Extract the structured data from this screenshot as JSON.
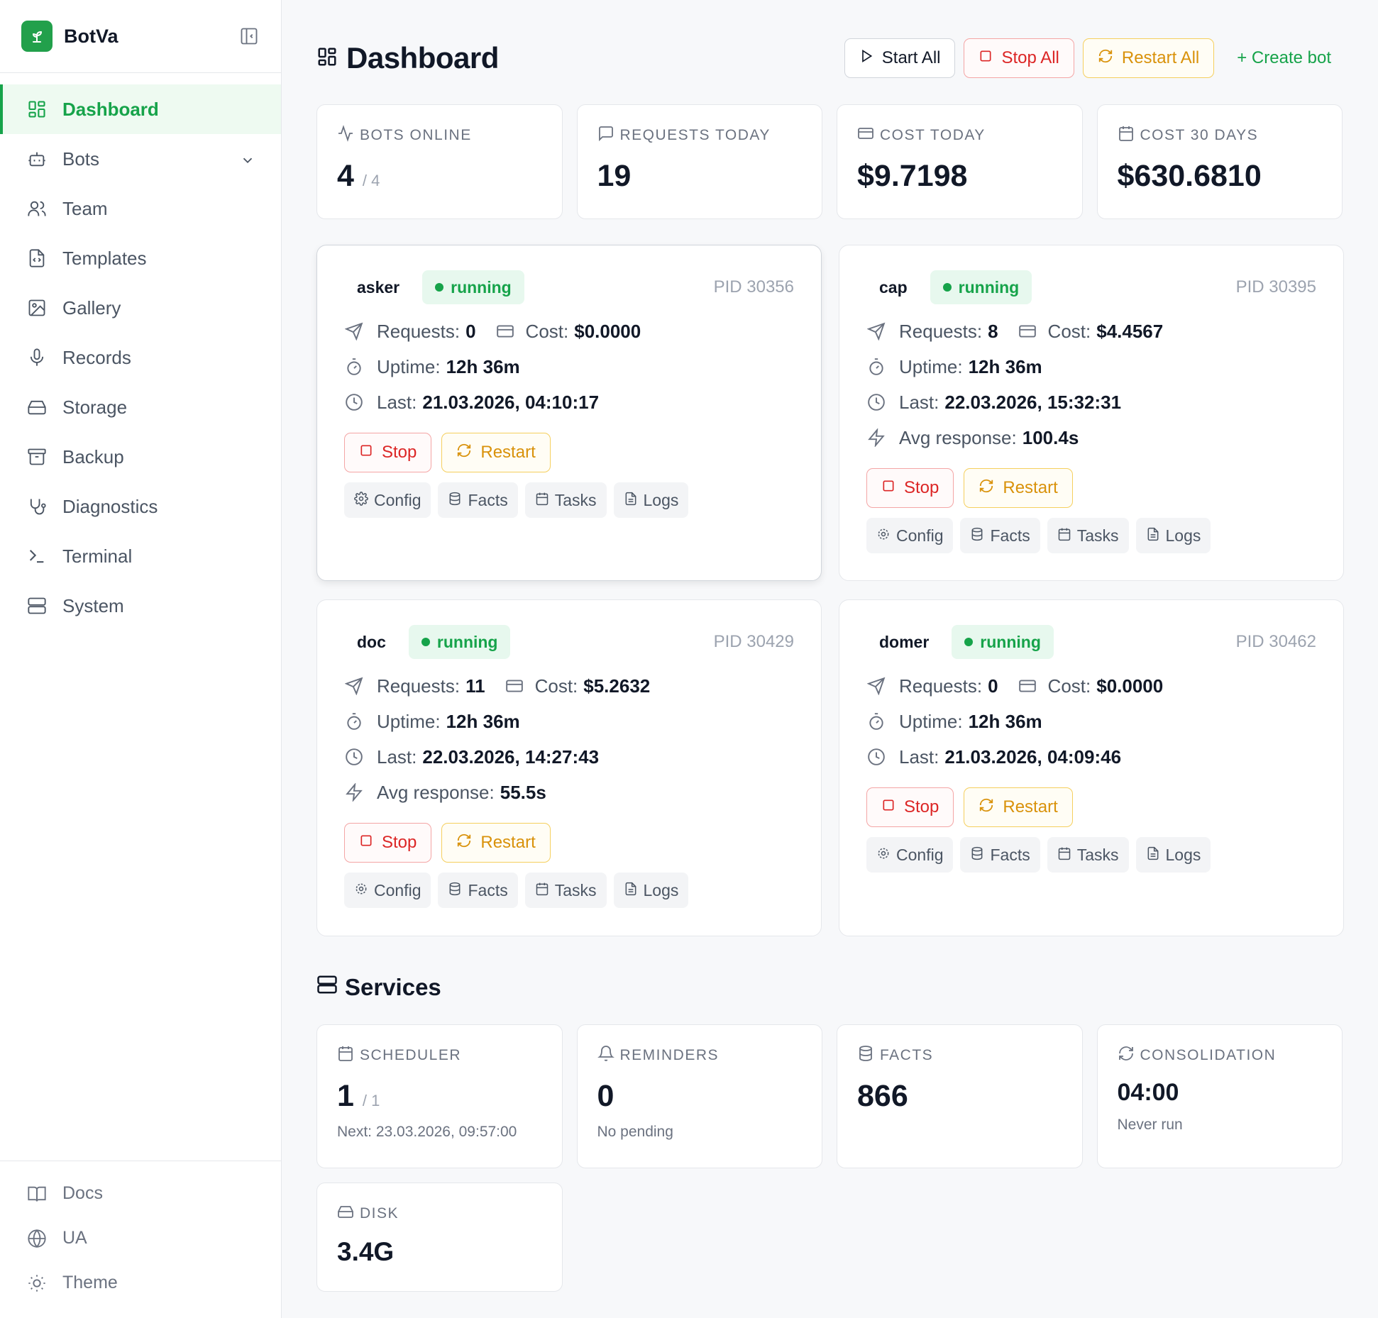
{
  "brand": {
    "name": "BotVa"
  },
  "sidebar": {
    "items": [
      {
        "label": "Dashboard",
        "icon": "layout-grid-icon",
        "active": true
      },
      {
        "label": "Bots",
        "icon": "bot-icon"
      },
      {
        "label": "Team",
        "icon": "users-icon"
      },
      {
        "label": "Templates",
        "icon": "file-code-icon"
      },
      {
        "label": "Gallery",
        "icon": "image-icon"
      },
      {
        "label": "Records",
        "icon": "mic-icon"
      },
      {
        "label": "Storage",
        "icon": "hard-drive-icon"
      },
      {
        "label": "Backup",
        "icon": "archive-icon"
      },
      {
        "label": "Diagnostics",
        "icon": "stethoscope-icon"
      },
      {
        "label": "Terminal",
        "icon": "terminal-icon"
      },
      {
        "label": "System",
        "icon": "server-icon"
      }
    ],
    "bottom": [
      {
        "label": "Docs",
        "icon": "book-icon"
      },
      {
        "label": "UA",
        "icon": "globe-icon"
      },
      {
        "label": "Theme",
        "icon": "sun-icon"
      }
    ]
  },
  "header": {
    "title": "Dashboard",
    "start_all": "Start All",
    "stop_all": "Stop All",
    "restart_all": "Restart All",
    "create_bot": "+ Create bot"
  },
  "stats": {
    "bots_online": {
      "label": "BOTS ONLINE",
      "value": "4",
      "total": "/ 4"
    },
    "requests_today": {
      "label": "REQUESTS TODAY",
      "value": "19"
    },
    "cost_today": {
      "label": "COST TODAY",
      "value": "$9.7198"
    },
    "cost_30": {
      "label": "COST 30 DAYS",
      "value": "$630.6810"
    }
  },
  "bot_labels": {
    "requests": "Requests:",
    "cost": "Cost:",
    "uptime": "Uptime:",
    "last": "Last:",
    "avg": "Avg response:",
    "stop": "Stop",
    "restart": "Restart",
    "config": "Config",
    "facts": "Facts",
    "tasks": "Tasks",
    "logs": "Logs"
  },
  "bots": [
    {
      "name": "asker",
      "status": "running",
      "pid": "PID 30356",
      "requests": "0",
      "cost": "$0.0000",
      "uptime": "12h 36m",
      "last": "21.03.2026, 04:10:17"
    },
    {
      "name": "cap",
      "status": "running",
      "pid": "PID 30395",
      "requests": "8",
      "cost": "$4.4567",
      "uptime": "12h 36m",
      "last": "22.03.2026, 15:32:31",
      "avg": "100.4s"
    },
    {
      "name": "doc",
      "status": "running",
      "pid": "PID 30429",
      "requests": "11",
      "cost": "$5.2632",
      "uptime": "12h 36m",
      "last": "22.03.2026, 14:27:43",
      "avg": "55.5s"
    },
    {
      "name": "domer",
      "status": "running",
      "pid": "PID 30462",
      "requests": "0",
      "cost": "$0.0000",
      "uptime": "12h 36m",
      "last": "21.03.2026, 04:09:46"
    }
  ],
  "services": {
    "title": "Services",
    "scheduler": {
      "label": "SCHEDULER",
      "value": "1",
      "total": "/ 1",
      "note": "Next: 23.03.2026, 09:57:00"
    },
    "reminders": {
      "label": "REMINDERS",
      "value": "0",
      "note": "No pending"
    },
    "facts": {
      "label": "FACTS",
      "value": "866"
    },
    "consolidation": {
      "label": "CONSOLIDATION",
      "value": "04:00",
      "note": "Never run"
    },
    "disk": {
      "label": "DISK",
      "value": "3.4G"
    }
  },
  "colors": {
    "accent": "#16a34a",
    "danger": "#dc2626",
    "warning": "#d9920b"
  }
}
